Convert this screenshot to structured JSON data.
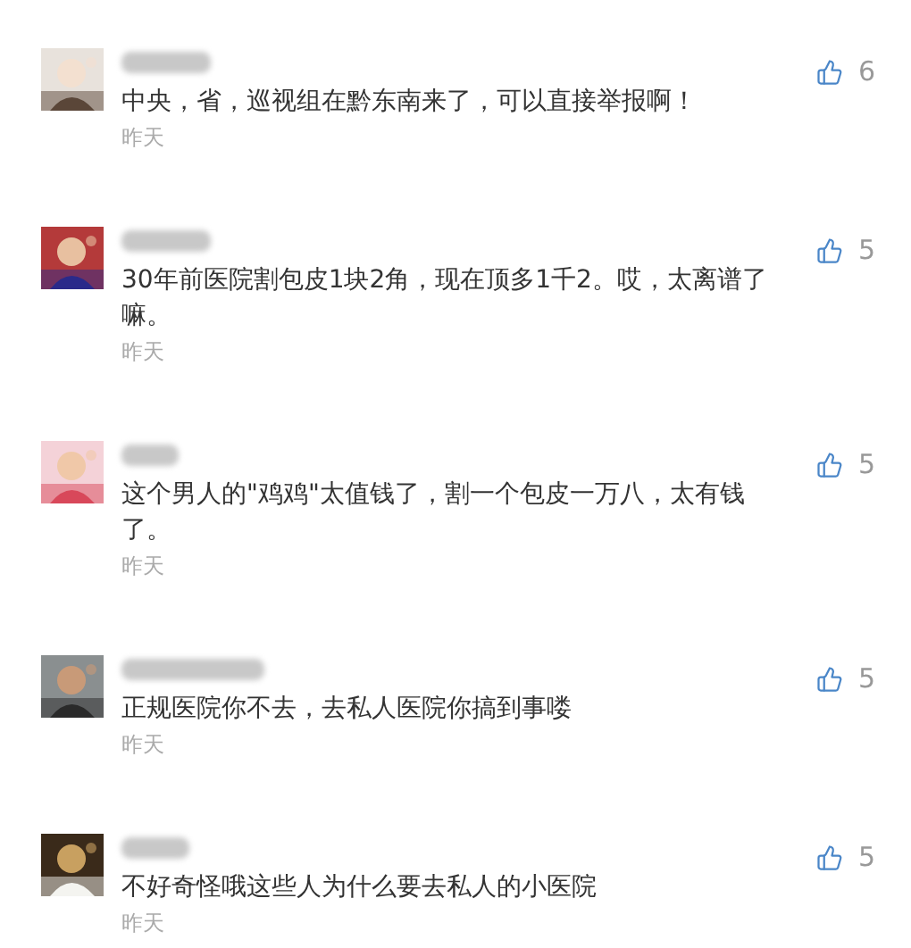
{
  "comments": [
    {
      "text": "中央，省，巡视组在黔东南来了，可以直接举报啊！",
      "time": "昨天",
      "likes": "6"
    },
    {
      "text": "30年前医院割包皮1块2角，现在顶多1千2。哎，太离谱了嘛。",
      "time": "昨天",
      "likes": "5"
    },
    {
      "text": "这个男人的\"鸡鸡\"太值钱了，割一个包皮一万八，太有钱了。",
      "time": "昨天",
      "likes": "5"
    },
    {
      "text": "正规医院你不去，去私人医院你搞到事喽",
      "time": "昨天",
      "likes": "5"
    },
    {
      "text": "不好奇怪哦这些人为什么要去私人的小医院",
      "time": "昨天",
      "likes": "5"
    }
  ]
}
